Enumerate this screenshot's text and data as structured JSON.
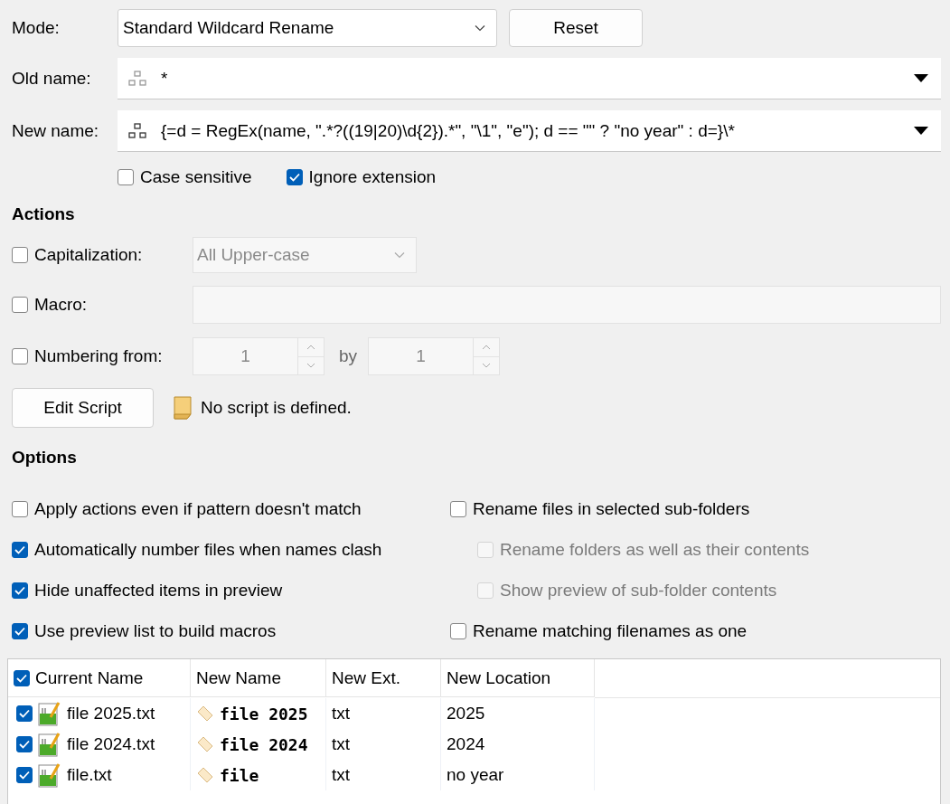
{
  "mode": {
    "label": "Mode:",
    "value": "Standard Wildcard Rename"
  },
  "reset_button": "Reset",
  "old_name": {
    "label": "Old name:",
    "value": "*"
  },
  "new_name": {
    "label": "New name:",
    "value": "{=d = RegEx(name, \".*?((19|20)\\d{2}).*\", \"\\1\", \"e\"); d == \"\" ? \"no year\" : d=}\\*"
  },
  "flags": [
    {
      "label": "Case sensitive",
      "checked": false
    },
    {
      "label": "Ignore extension",
      "checked": true
    }
  ],
  "actions_heading": "Actions",
  "capitalization": {
    "label": "Capitalization:",
    "checked": false,
    "value": "All Upper-case",
    "disabled": true
  },
  "macro": {
    "label": "Macro:",
    "checked": false,
    "disabled": true
  },
  "numbering": {
    "label": "Numbering from:",
    "checked": false,
    "from": "1",
    "by_label": "by",
    "by": "1",
    "disabled": true
  },
  "edit_script_button": "Edit Script",
  "script_status": "No script is defined.",
  "options_heading": "Options",
  "options_left": [
    {
      "label": "Apply actions even if pattern doesn't match",
      "checked": false
    },
    {
      "label": "Automatically number files when names clash",
      "checked": true
    },
    {
      "label": "Hide unaffected items in preview",
      "checked": true
    },
    {
      "label": "Use preview list to build macros",
      "checked": true
    }
  ],
  "options_right": [
    {
      "label": "Rename files in selected sub-folders",
      "checked": false,
      "kind": "top",
      "disabled": false
    },
    {
      "label": "Rename folders as well as their contents",
      "checked": false,
      "kind": "child",
      "disabled": true
    },
    {
      "label": "Show preview of sub-folder contents",
      "checked": false,
      "kind": "child",
      "disabled": true
    },
    {
      "label": "Rename matching filenames as one",
      "checked": false,
      "kind": "top",
      "disabled": false
    }
  ],
  "table": {
    "header_checked": true,
    "columns": [
      "Current Name",
      "New Name",
      "New Ext.",
      "New Location"
    ],
    "rows": [
      {
        "checked": true,
        "current_name": "file 2025.txt",
        "new_name": "file 2025",
        "new_ext": "txt",
        "new_location": "2025"
      },
      {
        "checked": true,
        "current_name": "file 2024.txt",
        "new_name": "file 2024",
        "new_ext": "txt",
        "new_location": "2024"
      },
      {
        "checked": true,
        "current_name": "file.txt",
        "new_name": "file",
        "new_ext": "txt",
        "new_location": "no year"
      }
    ]
  }
}
